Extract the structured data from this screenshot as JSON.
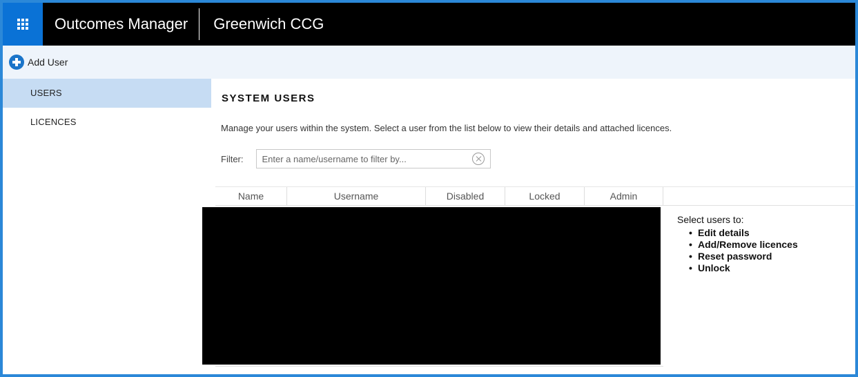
{
  "header": {
    "app_title": "Outcomes Manager",
    "org_title": "Greenwich CCG"
  },
  "actionbar": {
    "add_user_label": "Add User"
  },
  "sidebar": {
    "items": [
      {
        "label": "USERS",
        "active": true
      },
      {
        "label": "LICENCES",
        "active": false
      }
    ]
  },
  "main": {
    "title": "SYSTEM USERS",
    "description": "Manage your users within the system. Select a user from the list below to view their details and attached licences.",
    "filter": {
      "label": "Filter:",
      "placeholder": "Enter a name/username to filter by...",
      "value": ""
    },
    "table": {
      "columns": [
        "Name",
        "Username",
        "Disabled",
        "Locked",
        "Admin"
      ]
    },
    "help": {
      "title": "Select users to:",
      "items": [
        "Edit details",
        "Add/Remove licences",
        "Reset password",
        "Unlock"
      ]
    }
  },
  "colors": {
    "accent": "#2b88d8",
    "waffle_bg": "#0a72d6",
    "topbar_bg": "#000000",
    "actionbar_bg": "#eef4fb",
    "active_nav_bg": "#c6dcf3"
  }
}
